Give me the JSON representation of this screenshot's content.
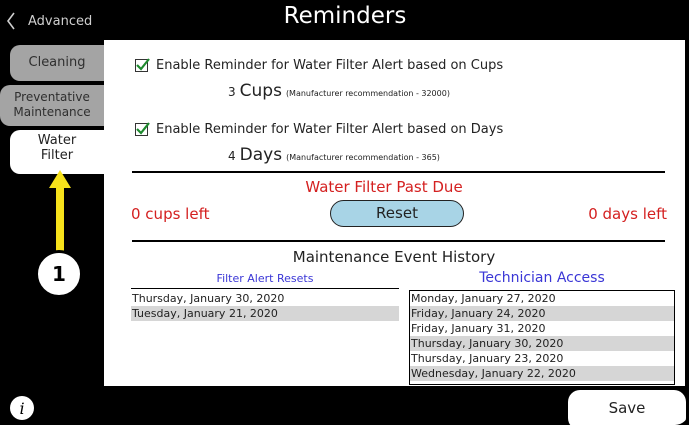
{
  "header": {
    "back_label": "Advanced",
    "title": "Reminders"
  },
  "sidebar": {
    "tabs": [
      {
        "label": "Cleaning"
      },
      {
        "label_line1": "Preventative",
        "label_line2": "Maintenance"
      },
      {
        "label_line1": "Water",
        "label_line2": "Filter"
      }
    ]
  },
  "annotation": {
    "callout_number": "1",
    "arrow_color": "#f7e21b"
  },
  "reminders": {
    "cups": {
      "checked": true,
      "label": "Enable Reminder for Water Filter Alert based on Cups",
      "value": "3",
      "unit": "Cups",
      "recommendation": "(Manufacturer recommendation - 32000)"
    },
    "days": {
      "checked": true,
      "label": "Enable Reminder for Water Filter Alert based on Days",
      "value": "4",
      "unit": "Days",
      "recommendation": "(Manufacturer recommendation - 365)"
    }
  },
  "status": {
    "past_due_label": "Water Filter Past Due",
    "cups_left": "0 cups left",
    "days_left": "0 days left",
    "reset_label": "Reset",
    "alert_color": "#d42020"
  },
  "history": {
    "title": "Maintenance Event History",
    "filter_alert_resets": {
      "header": "Filter Alert Resets",
      "rows": [
        "Thursday, January 30, 2020",
        "Tuesday, January 21, 2020"
      ]
    },
    "technician_access": {
      "header": "Technician Access",
      "rows": [
        "Monday, January 27, 2020",
        "Friday, January 24, 2020",
        "Friday, January 31, 2020",
        "Thursday, January 30, 2020",
        "Thursday, January 23, 2020",
        "Wednesday, January 22, 2020"
      ]
    }
  },
  "footer": {
    "info_label": "i",
    "save_label": "Save"
  }
}
